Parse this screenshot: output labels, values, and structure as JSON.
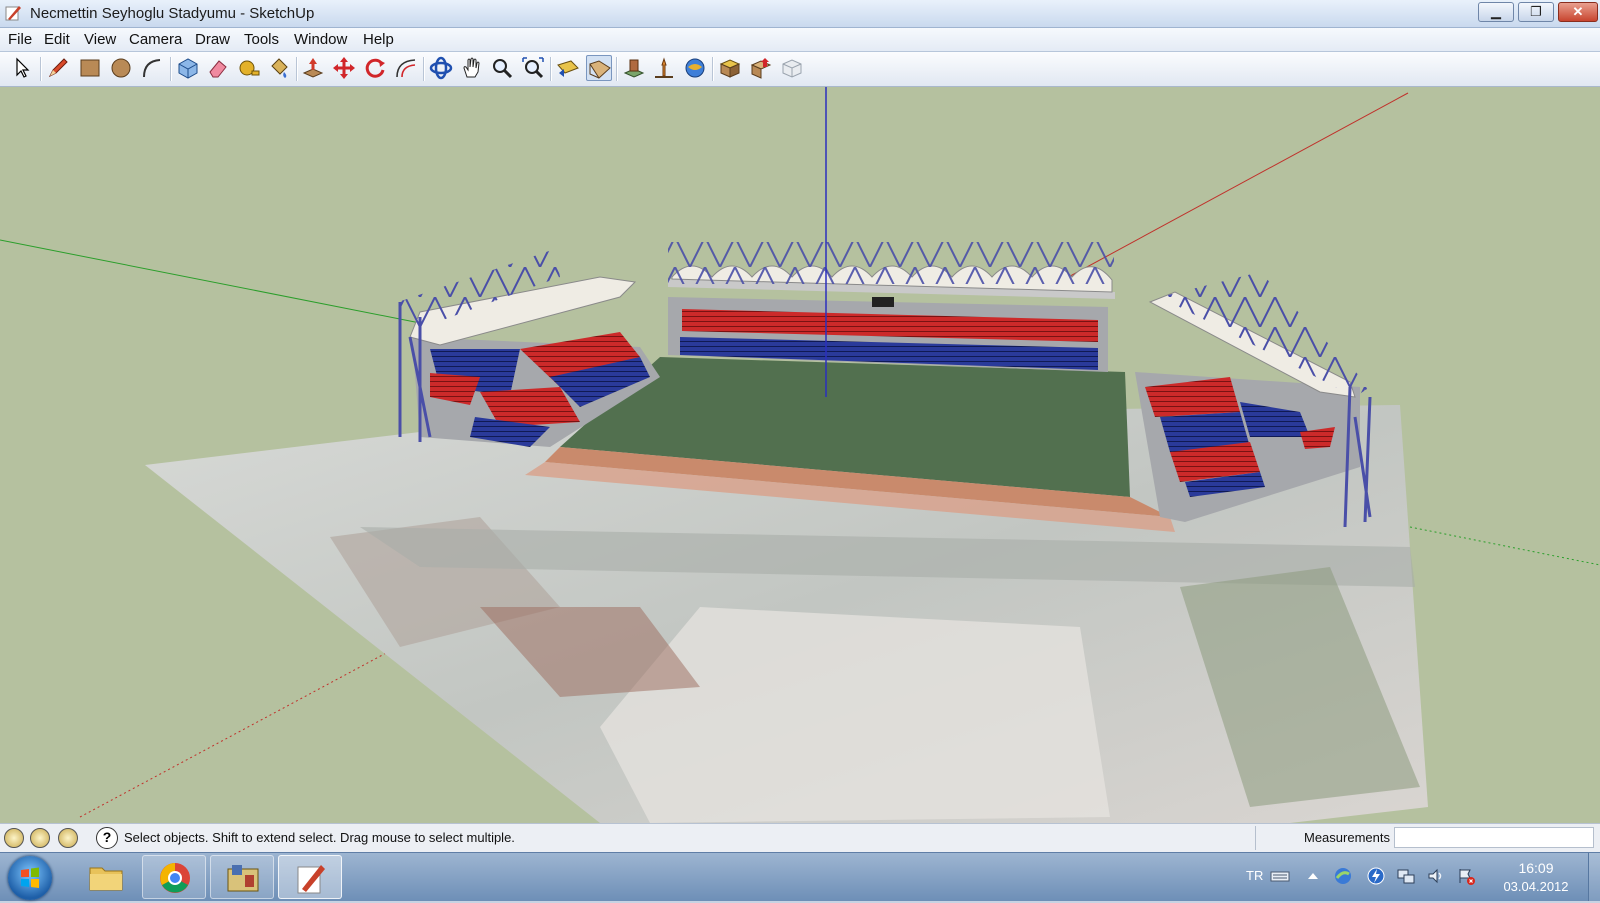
{
  "window": {
    "title": "Necmettin Seyhoglu Stadyumu - SketchUp",
    "controls": {
      "minimize": "▁",
      "maximize": "❐",
      "close": "✕"
    }
  },
  "menu": {
    "file": "File",
    "edit": "Edit",
    "view": "View",
    "camera": "Camera",
    "draw": "Draw",
    "tools": "Tools",
    "window": "Window",
    "help": "Help"
  },
  "toolbar": {
    "tools": [
      "select-icon",
      "pencil-icon",
      "rectangle-icon",
      "circle-icon",
      "arc-icon",
      "make-component-icon",
      "eraser-icon",
      "tape-measure-icon",
      "paint-bucket-icon",
      "push-pull-icon",
      "move-icon",
      "rotate-icon",
      "offset-icon",
      "orbit-icon",
      "pan-icon",
      "zoom-icon",
      "zoom-extents-icon",
      "previous-view-icon",
      "next-view-icon",
      "get-current-view-icon",
      "toggle-terrain-icon",
      "add-location-icon",
      "get-models-icon",
      "share-model-icon",
      "share-component-icon"
    ],
    "active_tool": "next-view-icon"
  },
  "statusbar": {
    "message": "Select objects. Shift to extend select. Drag mouse to select multiple.",
    "measurements_label": "Measurements",
    "help": "?"
  },
  "taskbar": {
    "apps": [
      "windows-explorer-icon",
      "google-chrome-icon",
      "sketchup-model-icon",
      "sketchup-icon"
    ],
    "tray_language": "TR",
    "clock_time": "16:09",
    "clock_date": "03.04.2012"
  },
  "colors": {
    "viewport_bg": "#b5c19f",
    "axis_red": "#c0312b",
    "axis_green": "#2b9e2b",
    "axis_blue": "#2b2fbd",
    "seat_red": "#cc2a2a",
    "seat_blue": "#2a3a9a"
  }
}
